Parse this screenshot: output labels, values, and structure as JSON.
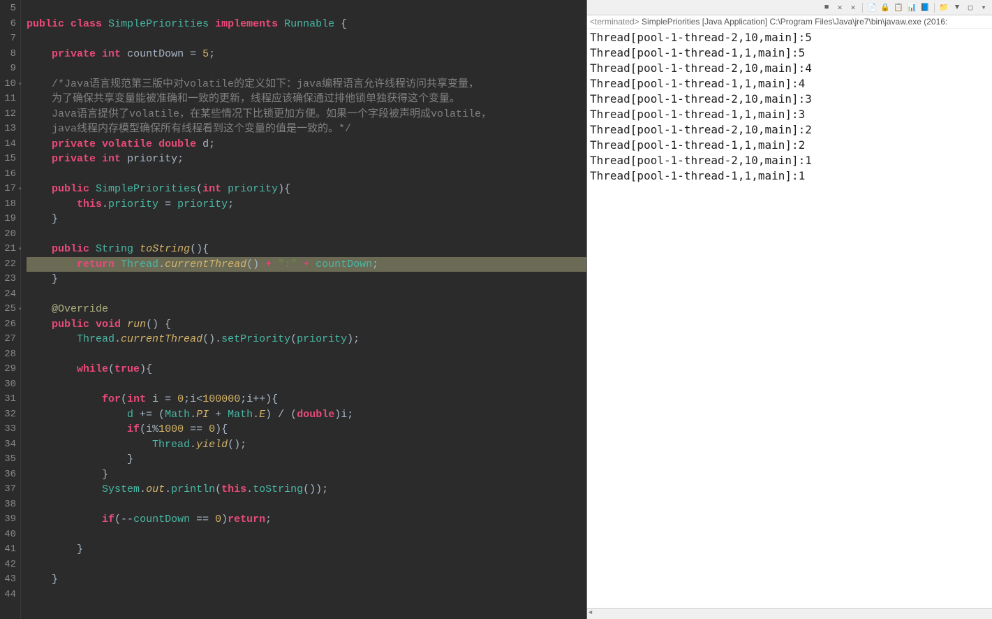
{
  "editor": {
    "first_line_number": 5,
    "highlighted_line": 22,
    "marker_lines": [
      10,
      17,
      21,
      25
    ],
    "lines": [
      {
        "n": 5,
        "tokens": []
      },
      {
        "n": 6,
        "tokens": [
          {
            "t": "public",
            "c": "kw"
          },
          {
            "t": " ",
            "c": "var"
          },
          {
            "t": "class",
            "c": "kw"
          },
          {
            "t": " ",
            "c": "var"
          },
          {
            "t": "SimplePriorities",
            "c": "ident"
          },
          {
            "t": " ",
            "c": "var"
          },
          {
            "t": "implements",
            "c": "kw"
          },
          {
            "t": " ",
            "c": "var"
          },
          {
            "t": "Runnable",
            "c": "ident"
          },
          {
            "t": " {",
            "c": "var"
          }
        ]
      },
      {
        "n": 7,
        "tokens": []
      },
      {
        "n": 8,
        "tokens": [
          {
            "t": "    ",
            "c": "var"
          },
          {
            "t": "private",
            "c": "kw"
          },
          {
            "t": " ",
            "c": "var"
          },
          {
            "t": "int",
            "c": "kw"
          },
          {
            "t": " ",
            "c": "var"
          },
          {
            "t": "countDown",
            "c": "var"
          },
          {
            "t": " = ",
            "c": "var"
          },
          {
            "t": "5",
            "c": "num"
          },
          {
            "t": ";",
            "c": "var"
          }
        ]
      },
      {
        "n": 9,
        "tokens": []
      },
      {
        "n": 10,
        "tokens": [
          {
            "t": "    ",
            "c": "var"
          },
          {
            "t": "/*Java语言规范第三版中对volatile的定义如下：java编程语言允许线程访问共享变量，",
            "c": "comment"
          }
        ]
      },
      {
        "n": 11,
        "tokens": [
          {
            "t": "    ",
            "c": "var"
          },
          {
            "t": "为了确保共享变量能被准确和一致的更新，线程应该确保通过排他锁单独获得这个变量。",
            "c": "comment"
          }
        ]
      },
      {
        "n": 12,
        "tokens": [
          {
            "t": "    ",
            "c": "var"
          },
          {
            "t": "Java语言提供了volatile，在某些情况下比锁更加方便。如果一个字段被声明成volatile，",
            "c": "comment"
          }
        ]
      },
      {
        "n": 13,
        "tokens": [
          {
            "t": "    ",
            "c": "var"
          },
          {
            "t": "java线程内存模型确保所有线程看到这个变量的值是一致的。*/",
            "c": "comment"
          }
        ]
      },
      {
        "n": 14,
        "tokens": [
          {
            "t": "    ",
            "c": "var"
          },
          {
            "t": "private",
            "c": "kw"
          },
          {
            "t": " ",
            "c": "var"
          },
          {
            "t": "volatile",
            "c": "kw"
          },
          {
            "t": " ",
            "c": "var"
          },
          {
            "t": "double",
            "c": "kw"
          },
          {
            "t": " ",
            "c": "var"
          },
          {
            "t": "d",
            "c": "var"
          },
          {
            "t": ";",
            "c": "var"
          }
        ]
      },
      {
        "n": 15,
        "tokens": [
          {
            "t": "    ",
            "c": "var"
          },
          {
            "t": "private",
            "c": "kw"
          },
          {
            "t": " ",
            "c": "var"
          },
          {
            "t": "int",
            "c": "kw"
          },
          {
            "t": " ",
            "c": "var"
          },
          {
            "t": "priority",
            "c": "var"
          },
          {
            "t": ";",
            "c": "var"
          }
        ]
      },
      {
        "n": 16,
        "tokens": []
      },
      {
        "n": 17,
        "tokens": [
          {
            "t": "    ",
            "c": "var"
          },
          {
            "t": "public",
            "c": "kw"
          },
          {
            "t": " ",
            "c": "var"
          },
          {
            "t": "SimplePriorities",
            "c": "ident"
          },
          {
            "t": "(",
            "c": "var"
          },
          {
            "t": "int",
            "c": "kw"
          },
          {
            "t": " ",
            "c": "var"
          },
          {
            "t": "priority",
            "c": "ident"
          },
          {
            "t": "){",
            "c": "var"
          }
        ]
      },
      {
        "n": 18,
        "tokens": [
          {
            "t": "        ",
            "c": "var"
          },
          {
            "t": "this",
            "c": "kw"
          },
          {
            "t": ".",
            "c": "var"
          },
          {
            "t": "priority",
            "c": "ident"
          },
          {
            "t": " = ",
            "c": "var"
          },
          {
            "t": "priority",
            "c": "ident"
          },
          {
            "t": ";",
            "c": "var"
          }
        ]
      },
      {
        "n": 19,
        "tokens": [
          {
            "t": "    }",
            "c": "var"
          }
        ]
      },
      {
        "n": 20,
        "tokens": []
      },
      {
        "n": 21,
        "tokens": [
          {
            "t": "    ",
            "c": "var"
          },
          {
            "t": "public",
            "c": "kw"
          },
          {
            "t": " ",
            "c": "var"
          },
          {
            "t": "String",
            "c": "ident"
          },
          {
            "t": " ",
            "c": "var"
          },
          {
            "t": "toString",
            "c": "method"
          },
          {
            "t": "(){",
            "c": "var"
          }
        ]
      },
      {
        "n": 22,
        "tokens": [
          {
            "t": "        ",
            "c": "var"
          },
          {
            "t": "return",
            "c": "kw"
          },
          {
            "t": " ",
            "c": "var"
          },
          {
            "t": "Thread",
            "c": "ident"
          },
          {
            "t": ".",
            "c": "var"
          },
          {
            "t": "currentThread",
            "c": "method"
          },
          {
            "t": "()",
            "c": "var"
          },
          {
            "t": " + ",
            "c": "op"
          },
          {
            "t": "\":\"",
            "c": "str"
          },
          {
            "t": " + ",
            "c": "op"
          },
          {
            "t": "countDown",
            "c": "ident"
          },
          {
            "t": ";",
            "c": "var"
          }
        ]
      },
      {
        "n": 23,
        "tokens": [
          {
            "t": "    }",
            "c": "var"
          }
        ]
      },
      {
        "n": 24,
        "tokens": []
      },
      {
        "n": 25,
        "tokens": [
          {
            "t": "    ",
            "c": "var"
          },
          {
            "t": "@Override",
            "c": "annotation"
          }
        ]
      },
      {
        "n": 26,
        "tokens": [
          {
            "t": "    ",
            "c": "var"
          },
          {
            "t": "public",
            "c": "kw"
          },
          {
            "t": " ",
            "c": "var"
          },
          {
            "t": "void",
            "c": "kw"
          },
          {
            "t": " ",
            "c": "var"
          },
          {
            "t": "run",
            "c": "method"
          },
          {
            "t": "() {",
            "c": "var"
          }
        ]
      },
      {
        "n": 27,
        "tokens": [
          {
            "t": "        ",
            "c": "var"
          },
          {
            "t": "Thread",
            "c": "ident"
          },
          {
            "t": ".",
            "c": "var"
          },
          {
            "t": "currentThread",
            "c": "method"
          },
          {
            "t": "().",
            "c": "var"
          },
          {
            "t": "setPriority",
            "c": "ident"
          },
          {
            "t": "(",
            "c": "var"
          },
          {
            "t": "priority",
            "c": "ident"
          },
          {
            "t": ");",
            "c": "var"
          }
        ]
      },
      {
        "n": 28,
        "tokens": []
      },
      {
        "n": 29,
        "tokens": [
          {
            "t": "        ",
            "c": "var"
          },
          {
            "t": "while",
            "c": "kw"
          },
          {
            "t": "(",
            "c": "var"
          },
          {
            "t": "true",
            "c": "kw"
          },
          {
            "t": "){",
            "c": "var"
          }
        ]
      },
      {
        "n": 30,
        "tokens": []
      },
      {
        "n": 31,
        "tokens": [
          {
            "t": "            ",
            "c": "var"
          },
          {
            "t": "for",
            "c": "kw"
          },
          {
            "t": "(",
            "c": "var"
          },
          {
            "t": "int",
            "c": "kw"
          },
          {
            "t": " ",
            "c": "var"
          },
          {
            "t": "i",
            "c": "var"
          },
          {
            "t": " = ",
            "c": "var"
          },
          {
            "t": "0",
            "c": "num"
          },
          {
            "t": ";",
            "c": "var"
          },
          {
            "t": "i",
            "c": "var"
          },
          {
            "t": "<",
            "c": "var"
          },
          {
            "t": "100000",
            "c": "num"
          },
          {
            "t": ";",
            "c": "var"
          },
          {
            "t": "i",
            "c": "var"
          },
          {
            "t": "++){",
            "c": "var"
          }
        ]
      },
      {
        "n": 32,
        "tokens": [
          {
            "t": "                ",
            "c": "var"
          },
          {
            "t": "d",
            "c": "ident"
          },
          {
            "t": " += (",
            "c": "var"
          },
          {
            "t": "Math",
            "c": "ident"
          },
          {
            "t": ".",
            "c": "var"
          },
          {
            "t": "PI",
            "c": "method"
          },
          {
            "t": " + ",
            "c": "var"
          },
          {
            "t": "Math",
            "c": "ident"
          },
          {
            "t": ".",
            "c": "var"
          },
          {
            "t": "E",
            "c": "method"
          },
          {
            "t": ") / (",
            "c": "var"
          },
          {
            "t": "double",
            "c": "kw"
          },
          {
            "t": ")",
            "c": "var"
          },
          {
            "t": "i",
            "c": "var"
          },
          {
            "t": ";",
            "c": "var"
          }
        ]
      },
      {
        "n": 33,
        "tokens": [
          {
            "t": "                ",
            "c": "var"
          },
          {
            "t": "if",
            "c": "kw"
          },
          {
            "t": "(",
            "c": "var"
          },
          {
            "t": "i",
            "c": "var"
          },
          {
            "t": "%",
            "c": "var"
          },
          {
            "t": "1000",
            "c": "num"
          },
          {
            "t": " == ",
            "c": "var"
          },
          {
            "t": "0",
            "c": "num"
          },
          {
            "t": "){",
            "c": "var"
          }
        ]
      },
      {
        "n": 34,
        "tokens": [
          {
            "t": "                    ",
            "c": "var"
          },
          {
            "t": "Thread",
            "c": "ident"
          },
          {
            "t": ".",
            "c": "var"
          },
          {
            "t": "yield",
            "c": "method"
          },
          {
            "t": "();",
            "c": "var"
          }
        ]
      },
      {
        "n": 35,
        "tokens": [
          {
            "t": "                }",
            "c": "var"
          }
        ]
      },
      {
        "n": 36,
        "tokens": [
          {
            "t": "            }",
            "c": "var"
          }
        ]
      },
      {
        "n": 37,
        "tokens": [
          {
            "t": "            ",
            "c": "var"
          },
          {
            "t": "System",
            "c": "ident"
          },
          {
            "t": ".",
            "c": "var"
          },
          {
            "t": "out",
            "c": "method"
          },
          {
            "t": ".",
            "c": "var"
          },
          {
            "t": "println",
            "c": "ident"
          },
          {
            "t": "(",
            "c": "var"
          },
          {
            "t": "this",
            "c": "kw"
          },
          {
            "t": ".",
            "c": "var"
          },
          {
            "t": "toString",
            "c": "ident"
          },
          {
            "t": "());",
            "c": "var"
          }
        ]
      },
      {
        "n": 38,
        "tokens": []
      },
      {
        "n": 39,
        "tokens": [
          {
            "t": "            ",
            "c": "var"
          },
          {
            "t": "if",
            "c": "kw"
          },
          {
            "t": "(--",
            "c": "var"
          },
          {
            "t": "countDown",
            "c": "ident"
          },
          {
            "t": " == ",
            "c": "var"
          },
          {
            "t": "0",
            "c": "num"
          },
          {
            "t": ")",
            "c": "var"
          },
          {
            "t": "return",
            "c": "kw"
          },
          {
            "t": ";",
            "c": "var"
          }
        ]
      },
      {
        "n": 40,
        "tokens": []
      },
      {
        "n": 41,
        "tokens": [
          {
            "t": "        }",
            "c": "var"
          }
        ]
      },
      {
        "n": 42,
        "tokens": []
      },
      {
        "n": 43,
        "tokens": [
          {
            "t": "    }",
            "c": "var"
          }
        ]
      },
      {
        "n": 44,
        "tokens": []
      }
    ]
  },
  "console": {
    "header_prefix": "<terminated>",
    "header_main": " SimplePriorities [Java Application] C:\\Program Files\\Java\\jre7\\bin\\javaw.exe (2016:",
    "output_lines": [
      "Thread[pool-1-thread-2,10,main]:5",
      "Thread[pool-1-thread-1,1,main]:5",
      "Thread[pool-1-thread-2,10,main]:4",
      "Thread[pool-1-thread-1,1,main]:4",
      "Thread[pool-1-thread-2,10,main]:3",
      "Thread[pool-1-thread-1,1,main]:3",
      "Thread[pool-1-thread-2,10,main]:2",
      "Thread[pool-1-thread-1,1,main]:2",
      "Thread[pool-1-thread-2,10,main]:1",
      "Thread[pool-1-thread-1,1,main]:1"
    ],
    "toolbar_icons": [
      "■",
      "✕",
      "✕",
      "|",
      "📄",
      "🔒",
      "📋",
      "📊",
      "📘",
      "|",
      "📁",
      "▼",
      "▢",
      "▾"
    ]
  }
}
